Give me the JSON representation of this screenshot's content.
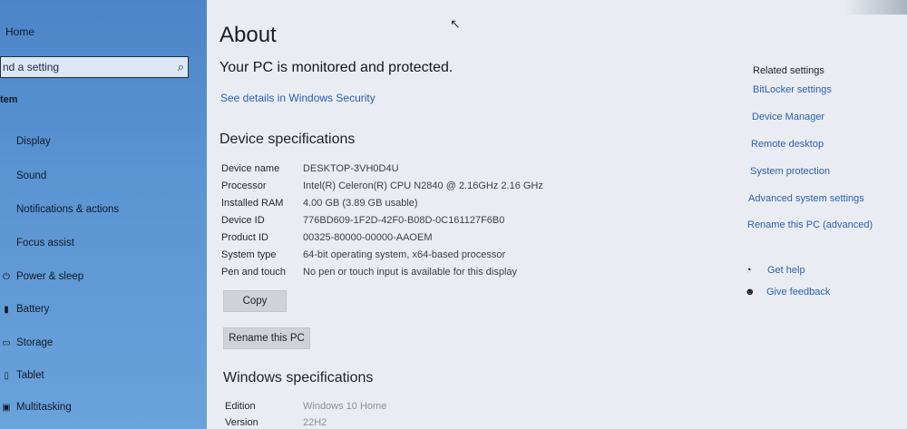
{
  "sidebar": {
    "home": "Home",
    "search_placeholder": "nd a setting",
    "section": "tem",
    "items": [
      {
        "label": "Display",
        "icon": "display-icon"
      },
      {
        "label": "Sound",
        "icon": "sound-icon"
      },
      {
        "label": "Notifications & actions",
        "icon": "notifications-icon"
      },
      {
        "label": "Focus assist",
        "icon": "focus-assist-icon"
      },
      {
        "label": "Power & sleep",
        "icon": "power-icon"
      },
      {
        "label": "Battery",
        "icon": "battery-icon"
      },
      {
        "label": "Storage",
        "icon": "storage-icon"
      },
      {
        "label": "Tablet",
        "icon": "tablet-icon"
      },
      {
        "label": "Multitasking",
        "icon": "multitasking-icon"
      }
    ]
  },
  "main": {
    "title": "About",
    "protected": "Your PC is monitored and protected.",
    "security_link": "See details in Windows Security",
    "device_specs_heading": "Device specifications",
    "device_specs": [
      {
        "label": "Device name",
        "value": "DESKTOP-3VH0D4U"
      },
      {
        "label": "Processor",
        "value": "Intel(R) Celeron(R) CPU  N2840  @ 2.16GHz   2.16 GHz"
      },
      {
        "label": "Installed RAM",
        "value": "4.00 GB (3.89 GB usable)"
      },
      {
        "label": "Device ID",
        "value": "776BD609-1F2D-42F0-B08D-0C161127F6B0"
      },
      {
        "label": "Product ID",
        "value": "00325-80000-00000-AAOEM"
      },
      {
        "label": "System type",
        "value": "64-bit operating system, x64-based processor"
      },
      {
        "label": "Pen and touch",
        "value": "No pen or touch input is available for this display"
      }
    ],
    "copy_button": "Copy",
    "rename_button": "Rename this PC",
    "windows_specs_heading": "Windows specifications",
    "windows_specs": [
      {
        "label": "Edition",
        "value": "Windows 10 Home"
      },
      {
        "label": "Version",
        "value": "22H2"
      }
    ]
  },
  "related": {
    "heading": "Related settings",
    "links": [
      "BitLocker settings",
      "Device Manager",
      "Remote desktop",
      "System protection",
      "Advanced system settings",
      "Rename this PC (advanced)"
    ],
    "get_help": "Get help",
    "give_feedback": "Give feedback"
  },
  "colors": {
    "sidebar": "#4d85c8",
    "link": "#2f5ea8",
    "background": "#e9edf3"
  }
}
